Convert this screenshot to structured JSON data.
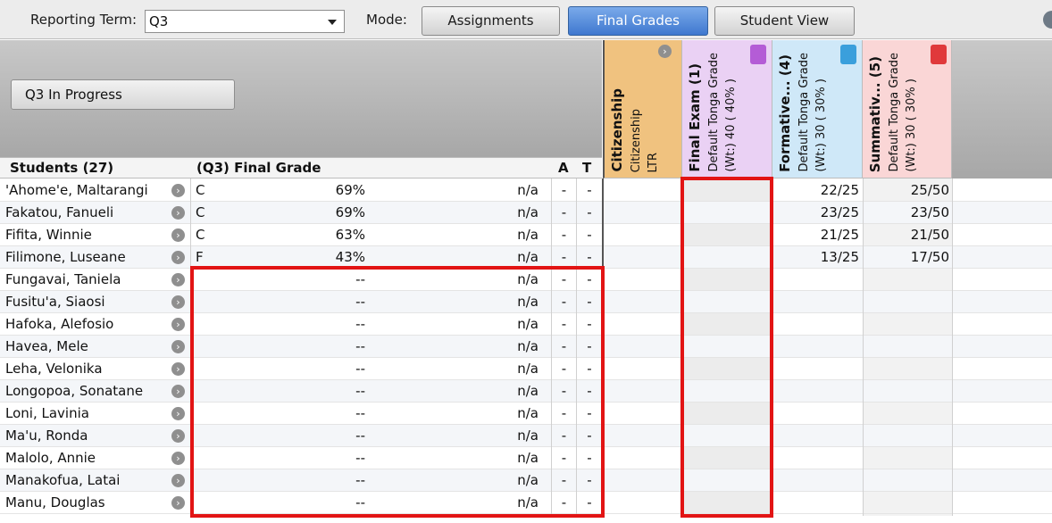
{
  "toolbar": {
    "term_label": "Reporting Term:",
    "term_value": "Q3",
    "mode_label": "Mode:",
    "modes": [
      {
        "label": "Assignments",
        "active": false
      },
      {
        "label": "Final Grades",
        "active": true
      },
      {
        "label": "Student View",
        "active": false
      }
    ]
  },
  "status_button": "Q3 In Progress",
  "column_headers": {
    "students": "Students (27)",
    "final_grade": "(Q3) Final Grade",
    "a": "A",
    "t": "T"
  },
  "grade_columns": [
    {
      "title": "Citizenship",
      "line2": "Citizenship",
      "line3": "LTR",
      "color": "#f0c27f",
      "icon": "arrow-right-icon"
    },
    {
      "title": "Final Exam (1)",
      "line2": "Default Tonga Grade",
      "line3": "(Wt:) 40 ( 40% )",
      "color": "#ead1f4",
      "icon": "purple-tag-icon"
    },
    {
      "title": "Formative... (4)",
      "line2": "Default Tonga Grade",
      "line3": "(Wt:) 30 ( 30% )",
      "color": "#cfe8f8",
      "icon": "blue-tag-icon"
    },
    {
      "title": "Summativ... (5)",
      "line2": "Default Tonga Grade",
      "line3": "(Wt:) 30 ( 30% )",
      "color": "#fad6d6",
      "icon": "red-tag-icon"
    }
  ],
  "students": [
    {
      "name": "'Ahome'e, Maltarangi",
      "letter": "C",
      "percent": "69%",
      "na": "n/a",
      "a": "-",
      "t": "-",
      "formative": "22/25",
      "summative": "25/50"
    },
    {
      "name": "Fakatou, Fanueli",
      "letter": "C",
      "percent": "69%",
      "na": "n/a",
      "a": "-",
      "t": "-",
      "formative": "23/25",
      "summative": "23/50"
    },
    {
      "name": "Fifita, Winnie",
      "letter": "C",
      "percent": "63%",
      "na": "n/a",
      "a": "-",
      "t": "-",
      "formative": "21/25",
      "summative": "21/50"
    },
    {
      "name": "Filimone, Luseane",
      "letter": "F",
      "percent": "43%",
      "na": "n/a",
      "a": "-",
      "t": "-",
      "formative": "13/25",
      "summative": "17/50"
    },
    {
      "name": "Fungavai, Taniela",
      "letter": "",
      "percent": "--",
      "na": "n/a",
      "a": "-",
      "t": "-",
      "formative": "",
      "summative": ""
    },
    {
      "name": "Fusitu'a, Siaosi",
      "letter": "",
      "percent": "--",
      "na": "n/a",
      "a": "-",
      "t": "-",
      "formative": "",
      "summative": ""
    },
    {
      "name": "Hafoka, Alefosio",
      "letter": "",
      "percent": "--",
      "na": "n/a",
      "a": "-",
      "t": "-",
      "formative": "",
      "summative": ""
    },
    {
      "name": "Havea, Mele",
      "letter": "",
      "percent": "--",
      "na": "n/a",
      "a": "-",
      "t": "-",
      "formative": "",
      "summative": ""
    },
    {
      "name": "Leha, Velonika",
      "letter": "",
      "percent": "--",
      "na": "n/a",
      "a": "-",
      "t": "-",
      "formative": "",
      "summative": ""
    },
    {
      "name": "Longopoa, Sonatane",
      "letter": "",
      "percent": "--",
      "na": "n/a",
      "a": "-",
      "t": "-",
      "formative": "",
      "summative": ""
    },
    {
      "name": "Loni, Lavinia",
      "letter": "",
      "percent": "--",
      "na": "n/a",
      "a": "-",
      "t": "-",
      "formative": "",
      "summative": ""
    },
    {
      "name": "Ma'u, Ronda",
      "letter": "",
      "percent": "--",
      "na": "n/a",
      "a": "-",
      "t": "-",
      "formative": "",
      "summative": ""
    },
    {
      "name": "Malolo, Annie",
      "letter": "",
      "percent": "--",
      "na": "n/a",
      "a": "-",
      "t": "-",
      "formative": "",
      "summative": ""
    },
    {
      "name": "Manakofua, Latai",
      "letter": "",
      "percent": "--",
      "na": "n/a",
      "a": "-",
      "t": "-",
      "formative": "",
      "summative": ""
    },
    {
      "name": "Manu, Douglas",
      "letter": "",
      "percent": "--",
      "na": "n/a",
      "a": "-",
      "t": "-",
      "formative": "",
      "summative": ""
    }
  ],
  "highlight_color": "#e21414"
}
